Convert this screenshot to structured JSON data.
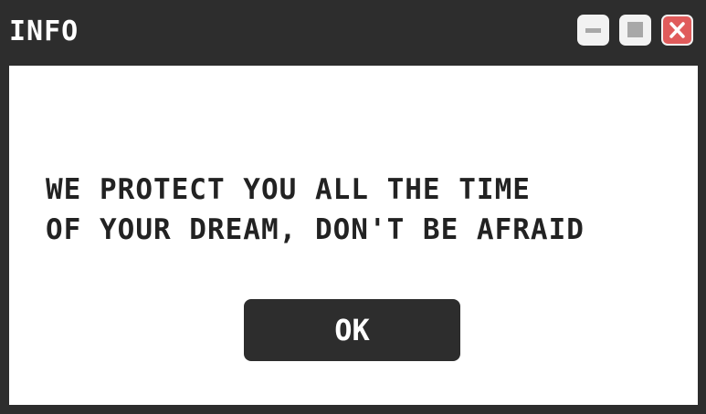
{
  "window": {
    "title": "INFO",
    "controls": {
      "minimize_icon": "minimize-icon",
      "maximize_icon": "maximize-icon",
      "close_icon": "close-icon"
    }
  },
  "dialog": {
    "message_line1": "WE PROTECT YOU ALL THE TIME",
    "message_line2": "OF YOUR DREAM, DON'T BE AFRAID",
    "ok_label": "OK"
  },
  "colors": {
    "frame": "#2d2d2d",
    "content_bg": "#ffffff",
    "text": "#222222",
    "close_button": "#e05b5b",
    "control_button": "#f2f2f2"
  }
}
